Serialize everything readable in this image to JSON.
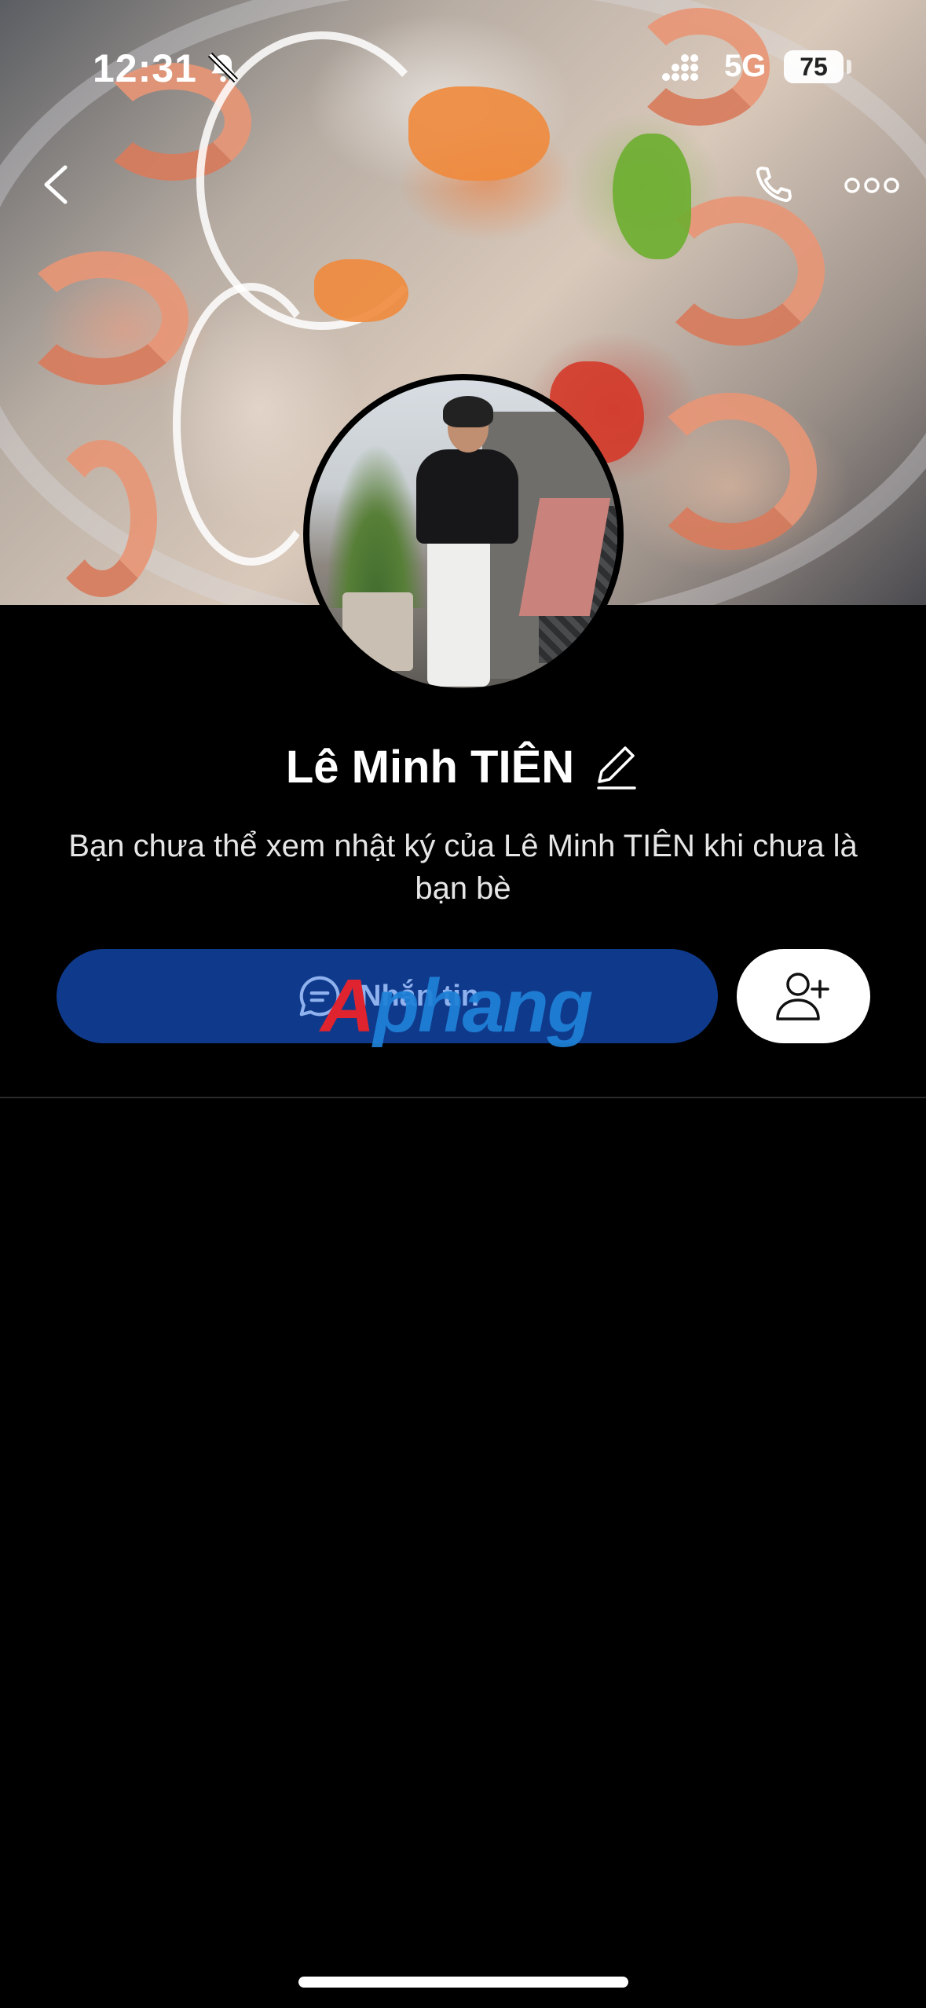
{
  "status_bar": {
    "time": "12:31",
    "network": "5G",
    "battery": "75",
    "icons": [
      "bell-slash-icon",
      "signal-icon",
      "battery-icon"
    ]
  },
  "cover": {
    "description_icon": "cover-photo"
  },
  "nav": {
    "back_icon": "chevron-left-icon",
    "call_icon": "phone-icon",
    "more_icon": "more-dots-icon"
  },
  "profile": {
    "name": "Lê Minh TIÊN",
    "edit_icon": "pencil-icon",
    "notice": "Bạn chưa thể xem nhật ký của Lê Minh TIÊN khi chưa là bạn bè"
  },
  "actions": {
    "message_label": "Nhắn tin",
    "message_icon": "chat-bubble-icon",
    "add_friend_icon": "add-user-icon"
  },
  "watermark": {
    "first": "A",
    "rest": "phang"
  },
  "colors": {
    "background": "#000000",
    "message_button": "#0f3a8c",
    "message_text": "#8fb2ee",
    "watermark_red": "#e0242f",
    "watermark_blue": "#1f82d8"
  }
}
